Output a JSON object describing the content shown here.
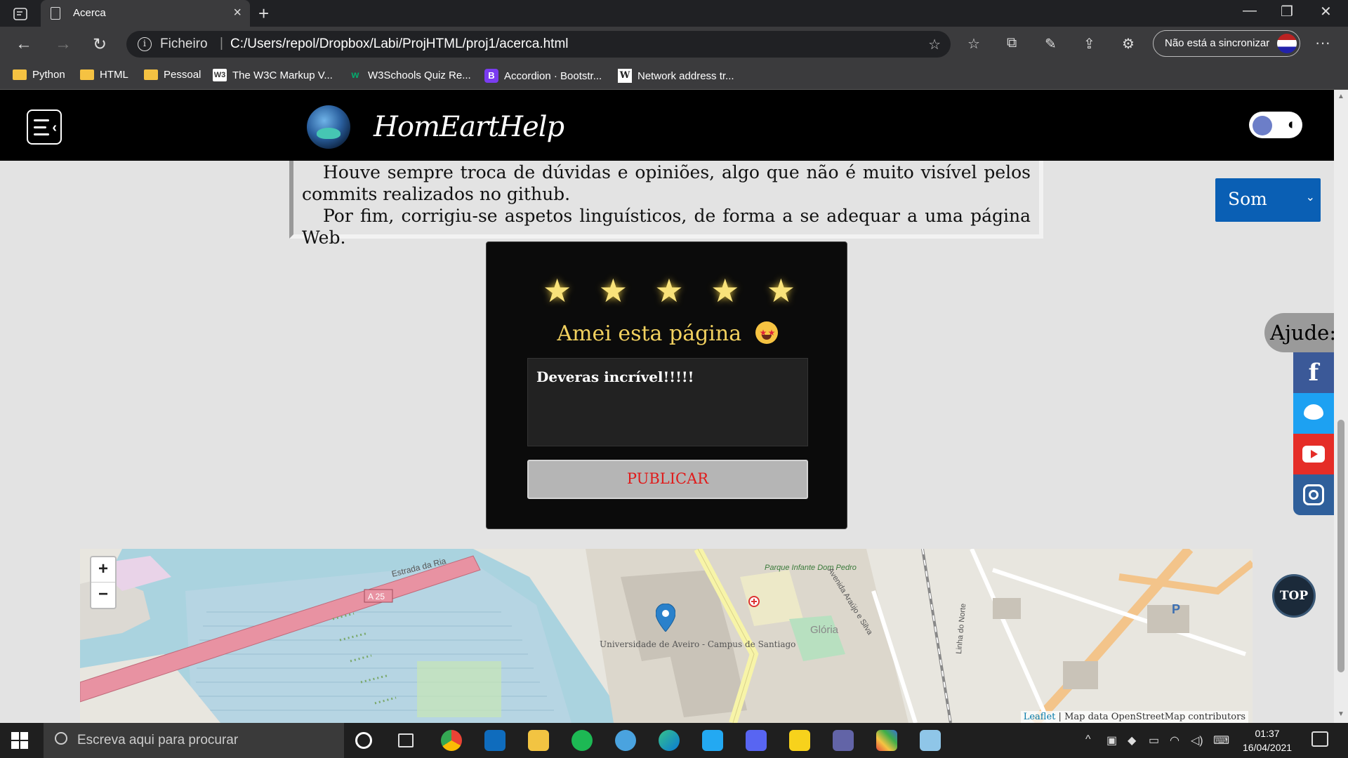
{
  "browser": {
    "tab_title": "Acerca",
    "address": {
      "scheme_label": "Ficheiro",
      "separator": "|",
      "url": "C:/Users/repol/Dropbox/Labi/ProjHTML/proj1/acerca.html"
    },
    "sync_label": "Não está a sincronizar",
    "bookmarks": [
      {
        "label": "Python",
        "icon": "folder-icon"
      },
      {
        "label": "HTML",
        "icon": "folder-icon"
      },
      {
        "label": "Pessoal",
        "icon": "folder-icon"
      },
      {
        "label": "The W3C Markup V...",
        "icon": "w3c-icon"
      },
      {
        "label": "W3Schools Quiz Re...",
        "icon": "w3schools-icon"
      },
      {
        "label": "Accordion · Bootstr...",
        "icon": "bootstrap-icon"
      },
      {
        "label": "Network address tr...",
        "icon": "wikipedia-icon"
      }
    ]
  },
  "site": {
    "brand": "HomEartHelp",
    "about_paragraphs": [
      "Houve sempre troca de dúvidas e opiniões, algo que não é muito visível pelos commits realizados no github.",
      "Por fim, corrigiu-se aspetos linguísticos, de forma a se adequar a uma página Web."
    ],
    "sound_select": {
      "selected": "Som"
    },
    "rating": {
      "stars_filled": 5,
      "stars_total": 5,
      "label": "Amei esta página",
      "emoji": "star-struck-emoji",
      "comment": "Deveras incrível!!!!!",
      "publish_label": "PUBLICAR"
    },
    "help": {
      "label": "Ajude:",
      "networks": [
        "facebook",
        "twitter",
        "youtube",
        "instagram"
      ]
    },
    "map": {
      "zoom_in": "+",
      "zoom_out": "−",
      "attribution_leaflet": "Leaflet",
      "attribution_sep": "|",
      "attribution_text": "Map data OpenStreetMap contributors",
      "labels": {
        "road_a25": "A 25",
        "estrada": "Estrada da Ria",
        "university": "Universidade de Aveiro - Campus de Santiago",
        "gloria": "Glória",
        "parque": "Parque Infante Dom Pedro",
        "avenida_araujo": "Avenida Araújo e Silva",
        "linha_norte": "Linha do Norte",
        "parking": "P"
      }
    },
    "top_button": "TOP"
  },
  "taskbar": {
    "search_placeholder": "Escreva aqui para procurar",
    "time": "01:37",
    "date": "16/04/2021"
  }
}
